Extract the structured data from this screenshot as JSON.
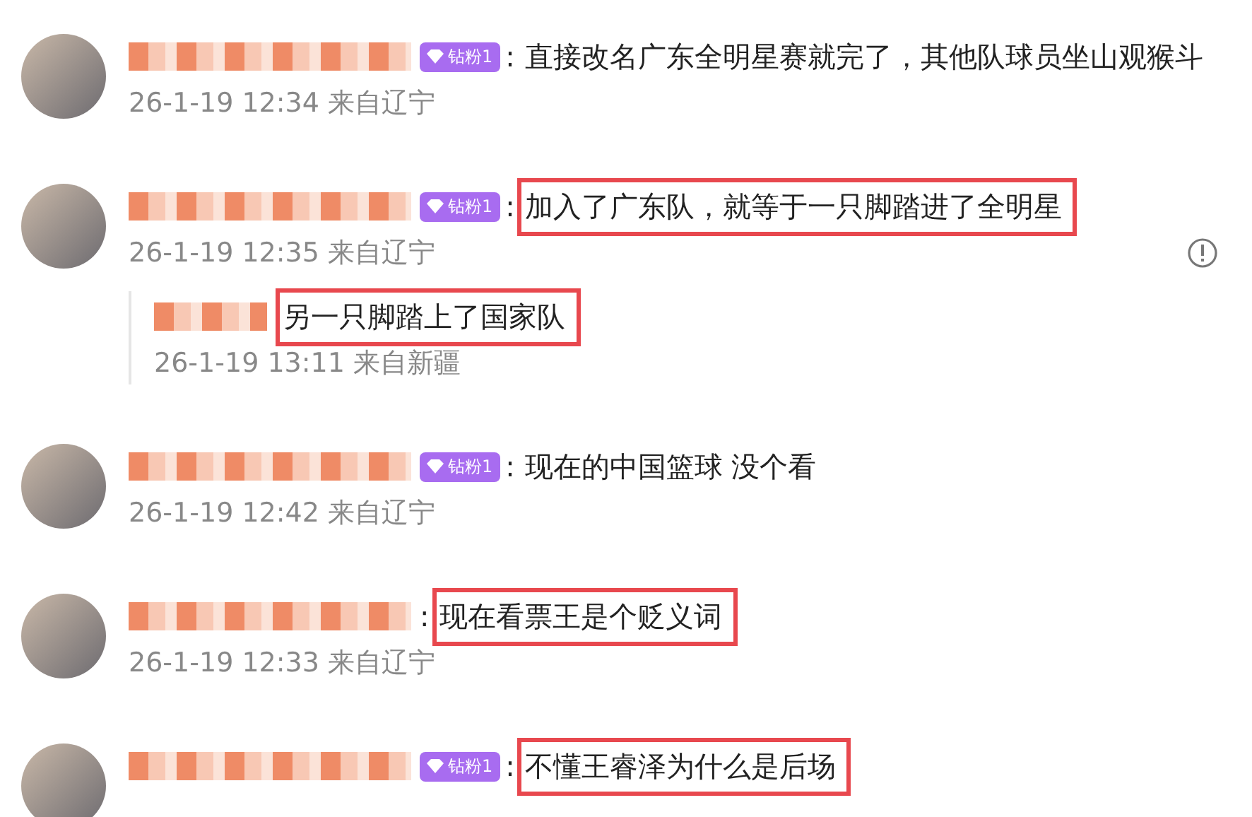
{
  "comments": [
    {
      "badge": "钻粉1",
      "colon": ":",
      "text": "直接改名广东全明星赛就完了，其他队球员坐山观猴斗",
      "highlighted": false,
      "time": "26-1-19 12:34 来自辽宁",
      "report_icon": false
    },
    {
      "badge": "钻粉1",
      "colon": ":",
      "text": "加入了广东队，就等于一只脚踏进了全明星",
      "highlighted": true,
      "time": "26-1-19 12:35 来自辽宁",
      "report_icon": true,
      "replies": [
        {
          "text": "另一只脚踏上了国家队",
          "highlighted": true,
          "time": "26-1-19 13:11 来自新疆"
        }
      ]
    },
    {
      "badge": "钻粉1",
      "colon": ":",
      "text": "现在的中国篮球 没个看",
      "highlighted": false,
      "time": "26-1-19 12:42 来自辽宁",
      "report_icon": false
    },
    {
      "colon": ":",
      "text": "现在看票王是个贬义词",
      "highlighted": true,
      "time": "26-1-19 12:33 来自辽宁",
      "report_icon": false
    },
    {
      "badge": "钻粉1",
      "colon": ":",
      "text": "不懂王睿泽为什么是后场",
      "highlighted": true,
      "report_icon": false
    }
  ]
}
